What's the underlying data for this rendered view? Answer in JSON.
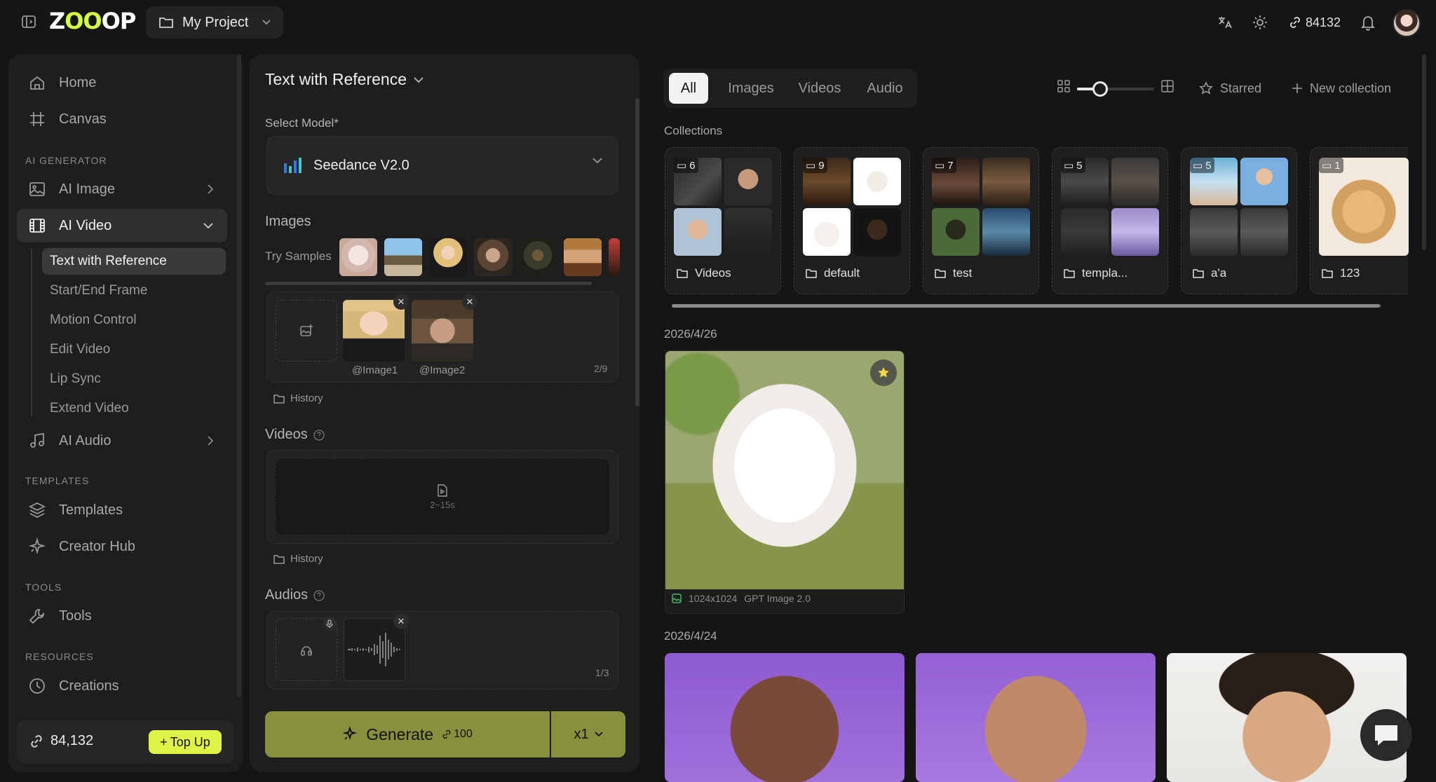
{
  "topbar": {
    "logo_prefix": "Z",
    "logo_highlight": "OO",
    "logo_suffix": "OP",
    "project_name": "My Project",
    "credits": "84132",
    "icons": [
      "sidebar-toggle-icon",
      "folder-icon",
      "translate-icon",
      "sun-icon",
      "link-icon",
      "bell-icon"
    ]
  },
  "sidebar": {
    "home": "Home",
    "canvas": "Canvas",
    "section_ai_generator": "AI GENERATOR",
    "ai_image": "AI Image",
    "ai_video": "AI Video",
    "sub_items": [
      "Text with Reference",
      "Start/End Frame",
      "Motion Control",
      "Edit Video",
      "Lip Sync",
      "Extend Video"
    ],
    "ai_audio": "AI Audio",
    "section_templates": "TEMPLATES",
    "templates": "Templates",
    "creator_hub": "Creator Hub",
    "section_tools": "TOOLS",
    "tools": "Tools",
    "section_resources": "RESOURCES",
    "creations": "Creations",
    "credits": "84,132",
    "top_up": "Top Up"
  },
  "panel": {
    "title": "Text with Reference",
    "select_model_label": "Select Model*",
    "model_name": "Seedance V2.0",
    "images_label": "Images",
    "try_samples": "Try Samples",
    "image_captions": [
      "@Image1",
      "@Image2"
    ],
    "image_count": "2/9",
    "history": "History",
    "videos_label": "Videos",
    "video_hint": "2~15s",
    "audios_label": "Audios",
    "audio_count": "1/3",
    "generate": "Generate",
    "generate_cost": "100",
    "multiplier": "x1"
  },
  "library": {
    "tabs": [
      "All",
      "Images",
      "Videos",
      "Audio"
    ],
    "active_tab": "All",
    "zoom_level": 0.3,
    "starred": "Starred",
    "new_collection": "New collection",
    "collections_label": "Collections",
    "collections": [
      {
        "count": "6",
        "name": "Videos"
      },
      {
        "count": "9",
        "name": "default"
      },
      {
        "count": "7",
        "name": "test"
      },
      {
        "count": "5",
        "name": "templa..."
      },
      {
        "count": "5",
        "name": "a'a"
      },
      {
        "count": "1",
        "name": "123"
      }
    ],
    "date_1": "2026/4/26",
    "card_1_size": "1024x1024",
    "card_1_model": "GPT Image 2.0",
    "date_2": "2026/4/24"
  },
  "colors": {
    "accent": "#ddf446",
    "generate": "#87913d",
    "background": "#151515",
    "panel": "#1e1e1e"
  }
}
